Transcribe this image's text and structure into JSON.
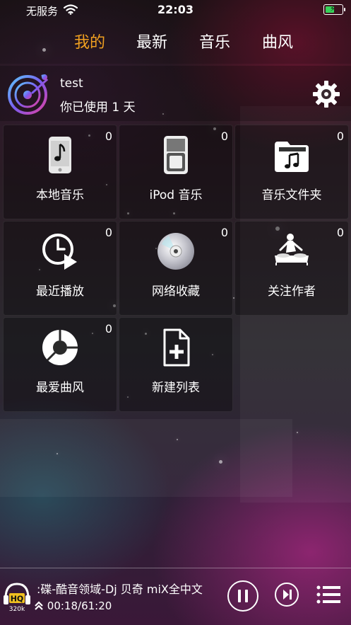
{
  "status_bar": {
    "carrier": "无服务",
    "time": "22:03",
    "battery_level": 0.55,
    "battery_color": "#36d158"
  },
  "tabs": [
    {
      "label": "我的",
      "active": true
    },
    {
      "label": "最新",
      "active": false
    },
    {
      "label": "音乐",
      "active": false
    },
    {
      "label": "曲风",
      "active": false
    }
  ],
  "accent_color": "#f0a020",
  "user": {
    "name": "test",
    "usage_text": "你已使用 1 天"
  },
  "tiles": [
    {
      "label": "本地音乐",
      "count": "0",
      "icon": "phone-music-icon"
    },
    {
      "label": "iPod 音乐",
      "count": "0",
      "icon": "ipod-icon"
    },
    {
      "label": "音乐文件夹",
      "count": "0",
      "icon": "music-folder-icon"
    },
    {
      "label": "最近播放",
      "count": "0",
      "icon": "recent-play-icon"
    },
    {
      "label": "网络收藏",
      "count": "0",
      "icon": "cd-disc-icon"
    },
    {
      "label": "关注作者",
      "count": "0",
      "icon": "dj-artist-icon"
    },
    {
      "label": "最爱曲风",
      "count": "0",
      "icon": "genre-disc-icon"
    },
    {
      "label": "新建列表",
      "icon": "new-list-icon"
    }
  ],
  "player": {
    "quality_label": "HQ",
    "bitrate": "320k",
    "song_title": ":碟-酷音领域-Dj 贝奇 miX全中文",
    "progress_text": "00:18/61:20"
  }
}
